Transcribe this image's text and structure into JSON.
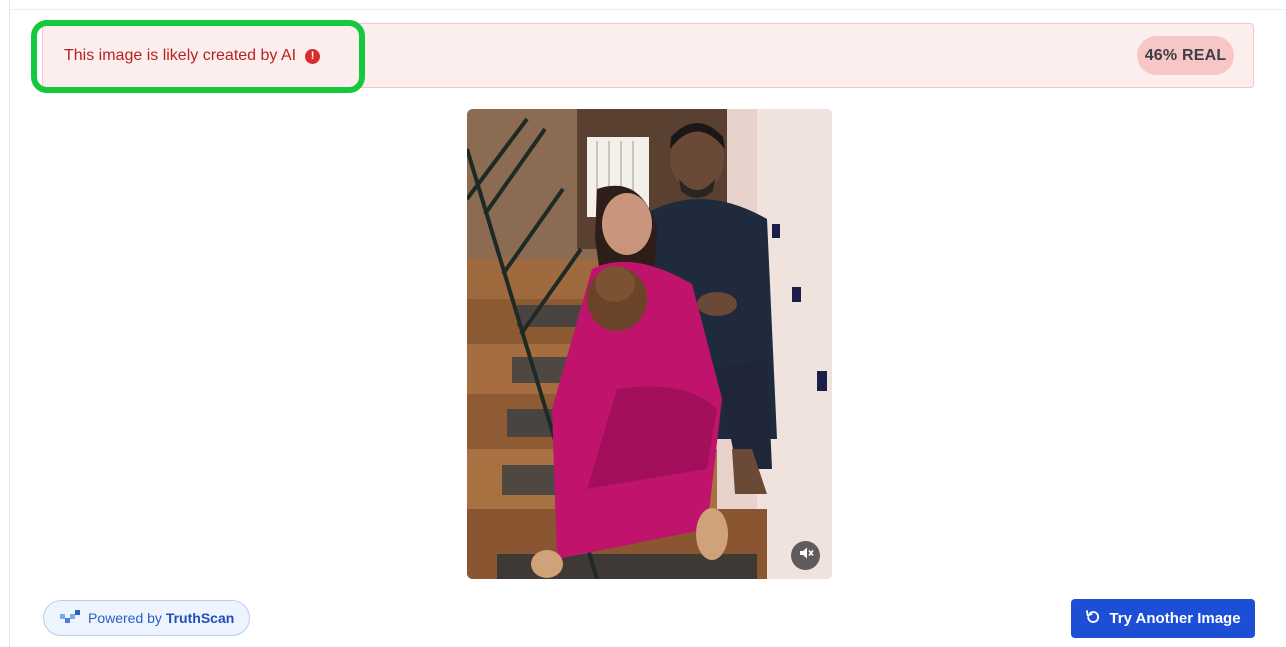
{
  "alert": {
    "message": "This image is likely created by AI",
    "icon": "exclamation-circle-icon",
    "text_color": "#b42323",
    "background": "#fdeeee",
    "highlight_color": "#15c83e"
  },
  "score": {
    "label": "46% REAL",
    "value_percent": 46,
    "badge_color": "#f7c7c7"
  },
  "media": {
    "mute_icon": "speaker-muted-icon"
  },
  "footer": {
    "powered_prefix": "Powered by",
    "powered_brand": "TruthScan",
    "brand_icon": "truthscan-logo-icon",
    "try_again_label": "Try Another Image",
    "try_again_icon": "refresh-icon",
    "accent": "#1c4fd6"
  }
}
